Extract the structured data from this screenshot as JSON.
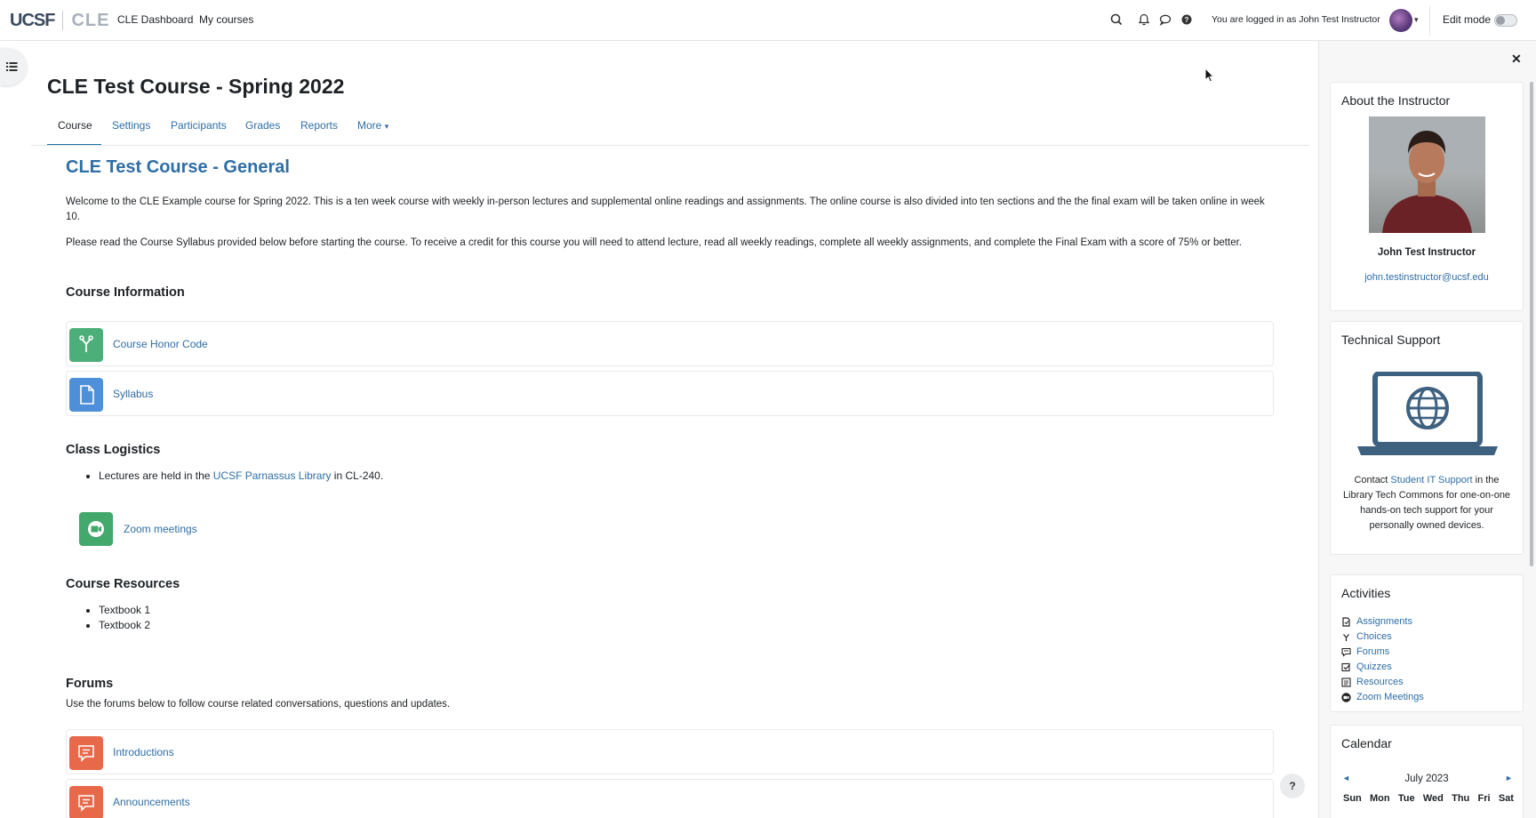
{
  "navbar": {
    "logo_primary": "UCSF",
    "logo_secondary": "CLE",
    "links": [
      "CLE Dashboard",
      "My courses"
    ],
    "icons": [
      "search-icon",
      "bell-icon",
      "chat-icon",
      "question-icon"
    ],
    "logged_in_text": "You are logged in as John Test Instructor",
    "edit_mode_label": "Edit mode",
    "edit_mode_on": false
  },
  "course": {
    "title": "CLE Test Course - Spring 2022",
    "tabs": [
      "Course",
      "Settings",
      "Participants",
      "Grades",
      "Reports",
      "More"
    ],
    "active_tab": "Course",
    "section_title": "CLE Test Course - General",
    "intro_1": "Welcome to the CLE Example course for Spring 2022. This is a ten week course with weekly in-person lectures and supplemental online readings and assignments. The online course is also divided into ten sections and the the final exam will be taken online in week 10.",
    "intro_2": "Please read the Course Syllabus provided below before starting the course. To receive a credit for this course you will need to attend lecture, read all weekly readings, complete all weekly assignments, and complete the Final Exam with a score of 75% or better.",
    "course_information": {
      "heading": "Course Information",
      "items": [
        {
          "label": "Course Honor Code",
          "icon": "choice-icon",
          "color": "#4caf7a"
        },
        {
          "label": "Syllabus",
          "icon": "file-icon",
          "color": "#4d8fd8"
        }
      ]
    },
    "class_logistics": {
      "heading": "Class Logistics",
      "bullet_before": "Lectures are held in the ",
      "bullet_link": "UCSF Parnassus Library",
      "bullet_after": " in CL-240.",
      "zoom_label": "Zoom meetings",
      "zoom_color": "#43a86b"
    },
    "course_resources": {
      "heading": "Course Resources",
      "items": [
        "Textbook 1",
        "Textbook 2"
      ]
    },
    "forums": {
      "heading": "Forums",
      "description": "Use the forums below to follow course related conversations, questions and updates.",
      "items": [
        {
          "label": "Introductions",
          "color": "#e8684a"
        },
        {
          "label": "Announcements",
          "color": "#e8684a"
        }
      ]
    },
    "help_button": "?"
  },
  "drawer": {
    "about": {
      "title": "About the Instructor",
      "name": "John Test Instructor",
      "email": "john.testinstructor@ucsf.edu"
    },
    "support": {
      "title": "Technical Support",
      "text_before": "Contact ",
      "link": "Student IT Support",
      "text_after": " in the Library Tech Commons for one-on-one hands-on tech support for your personally owned devices."
    },
    "activities": {
      "title": "Activities",
      "items": [
        "Assignments",
        "Choices",
        "Forums",
        "Quizzes",
        "Resources",
        "Zoom Meetings"
      ]
    },
    "calendar": {
      "title": "Calendar",
      "month": "July 2023",
      "prev": "◄",
      "next": "►",
      "weekdays": [
        "Sun",
        "Mon",
        "Tue",
        "Wed",
        "Thu",
        "Fri",
        "Sat"
      ]
    }
  },
  "colors": {
    "link": "#2f6ea5",
    "text": "#1d2125"
  }
}
